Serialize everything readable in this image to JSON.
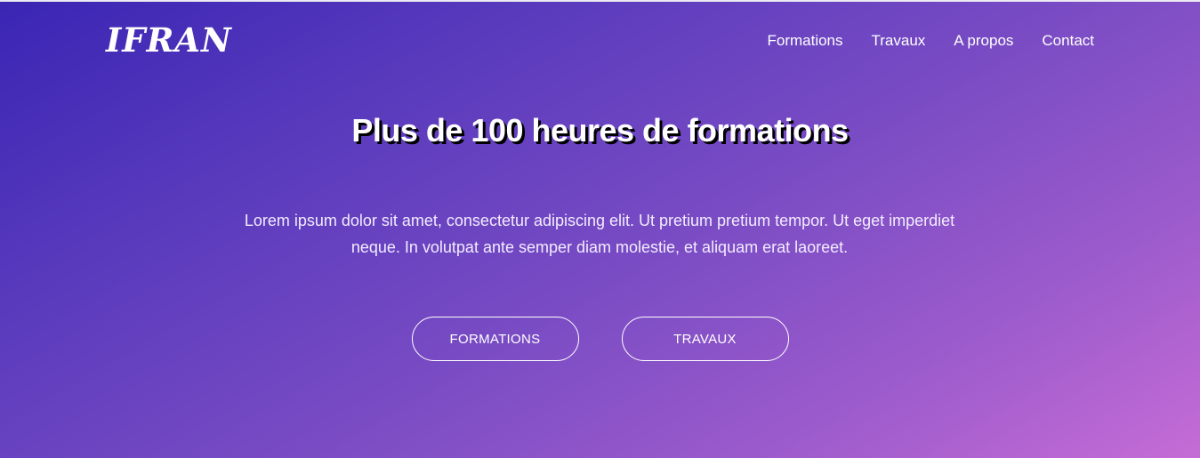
{
  "brand": {
    "logo_text": "IFRAN"
  },
  "nav": {
    "items": [
      {
        "label": "Formations"
      },
      {
        "label": "Travaux"
      },
      {
        "label": "A propos"
      },
      {
        "label": "Contact"
      }
    ]
  },
  "hero": {
    "headline": "Plus de 100 heures de formations",
    "description": "Lorem ipsum dolor sit amet, consectetur adipiscing elit. Ut pretium pretium tempor. Ut eget imperdiet neque. In volutpat ante semper diam molestie, et aliquam erat laoreet.",
    "buttons": [
      {
        "label": "FORMATIONS"
      },
      {
        "label": "TRAVAUX"
      }
    ]
  },
  "colors": {
    "gradient_start": "#3a25b4",
    "gradient_end": "#c56cd6",
    "text": "#ffffff",
    "headline_shadow": "#000000"
  }
}
